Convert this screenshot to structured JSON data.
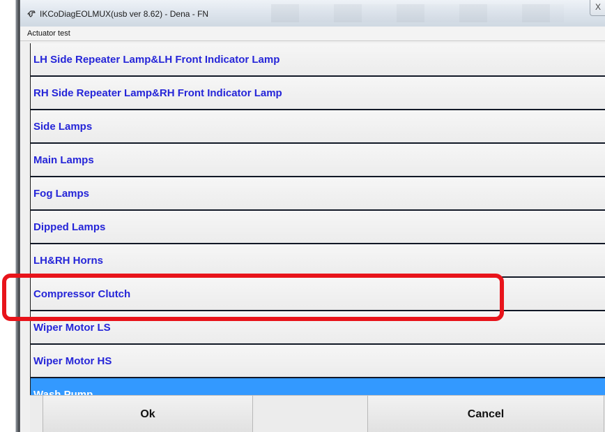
{
  "window": {
    "title": "IKCoDiagEOLMUX(usb ver 8.62)  - Dena - FN",
    "close_glyph": "X"
  },
  "dialog": {
    "caption": "Actuator test"
  },
  "actuators": [
    {
      "label": "LH Side Repeater Lamp&LH Front Indicator Lamp"
    },
    {
      "label": "RH Side Repeater Lamp&RH Front Indicator Lamp"
    },
    {
      "label": "Side Lamps"
    },
    {
      "label": "Main Lamps"
    },
    {
      "label": "Fog Lamps"
    },
    {
      "label": "Dipped Lamps"
    },
    {
      "label": "LH&RH Horns"
    },
    {
      "label": "Compressor Clutch"
    },
    {
      "label": "Wiper Motor LS"
    },
    {
      "label": "Wiper Motor HS"
    },
    {
      "label": "Wash Pump",
      "selected": true
    }
  ],
  "footer": {
    "ok_label": "Ok",
    "cancel_label": "Cancel"
  },
  "colors": {
    "item_text": "#2525d8",
    "selected_bg": "#3399ff",
    "highlight": "#e8141b"
  },
  "icons": {
    "title": "app-icon"
  }
}
